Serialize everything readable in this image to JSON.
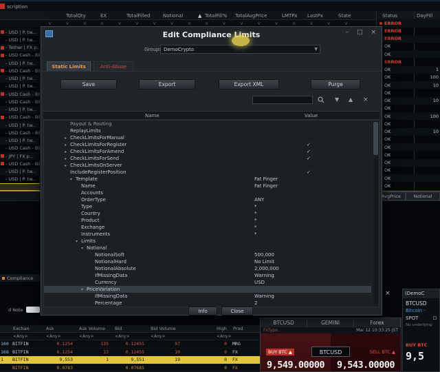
{
  "chrome": {
    "partial_header": "scription",
    "columns": [
      "TotalQty",
      "EX",
      "TotalFilled",
      "Notional",
      "TotalFill%",
      "TotalAvgPrice",
      "LMTPx",
      "LastPx",
      "State",
      "Status",
      "DayFill"
    ],
    "sort_indicator": "▲",
    "filter_glyphs": "∨ ∨ ∨ ∨ ∨ ∨ ∨ ∨ ∨ ∨ ∨ ∨ ∨ ∨ ∨ ∨ ∨ ∨",
    "left_rows": [
      {
        "label": "- USD | P. tw...",
        "marker": "red"
      },
      {
        "label": "- USD | P. tw...",
        "marker": ""
      },
      {
        "label": "- Tether | FX p...",
        "marker": "red"
      },
      {
        "label": "- USD Cash - Bitco...",
        "marker": "red"
      },
      {
        "label": "- USD | P. tw...",
        "marker": ""
      },
      {
        "label": "- USD Cash - Bitco...",
        "marker": "red"
      },
      {
        "label": "- USD | P. tw...",
        "marker": ""
      },
      {
        "label": "- USD | P. tw...",
        "marker": ""
      },
      {
        "label": "- USD Cash - Bitco...",
        "marker": "red"
      },
      {
        "label": "- USD Cash - Bitco...",
        "marker": ""
      },
      {
        "label": "- USD | P. tw...",
        "marker": ""
      },
      {
        "label": "- USD Cash - Bitco...",
        "marker": "red"
      },
      {
        "label": "- USD | P. tw...",
        "marker": ""
      },
      {
        "label": "- USD Cash - Bitco...",
        "marker": ""
      },
      {
        "label": "- USD | P. tw...",
        "marker": ""
      },
      {
        "label": "- USD Cash - Bitco...",
        "marker": ""
      },
      {
        "label": "- JPY | FX p...",
        "marker": "red"
      },
      {
        "label": "- USD Cash - Bitco...",
        "marker": "red"
      },
      {
        "label": "- USD | P. tw...",
        "marker": ""
      },
      {
        "label": "- USD | P. tw...",
        "marker": ""
      }
    ],
    "status_rows": [
      {
        "status": "ERROR",
        "value": ""
      },
      {
        "status": "ERROR",
        "value": ""
      },
      {
        "status": "ERROR",
        "value": ""
      },
      {
        "status": "OK",
        "value": ""
      },
      {
        "status": "OK",
        "value": ""
      },
      {
        "status": "ERROR",
        "value": ""
      },
      {
        "status": "OK",
        "value": "1"
      },
      {
        "status": "OK",
        "value": "100"
      },
      {
        "status": "OK",
        "value": "10"
      },
      {
        "status": "OK",
        "value": ""
      },
      {
        "status": "OK",
        "value": "10"
      },
      {
        "status": "OK",
        "value": ""
      },
      {
        "status": "OK",
        "value": "100"
      },
      {
        "status": "OK",
        "value": ""
      },
      {
        "status": "OK",
        "value": "10"
      },
      {
        "status": "OK",
        "value": ""
      },
      {
        "status": "OK",
        "value": ""
      },
      {
        "status": "OK",
        "value": ""
      },
      {
        "status": "OK",
        "value": ""
      },
      {
        "status": "OK",
        "value": ""
      },
      {
        "status": "OK",
        "value": ""
      },
      {
        "status": "OK",
        "value": ""
      }
    ],
    "mid": {
      "avgprice": "AvgPrice",
      "notional": "Notional"
    },
    "left_panel": {
      "compliance": "Compliance",
      "note": "d Note"
    }
  },
  "modal": {
    "title": "Edit Compliance Limits",
    "window_controls": {
      "minimize": "–",
      "maximize": "□",
      "close": "×"
    },
    "groups_label": "Groups",
    "groups_value": "DemoCrypto",
    "dropdown_arrow": "▼",
    "tabs": [
      {
        "label": "Static Limits"
      },
      {
        "label": "Anti-Abuse"
      }
    ],
    "buttons": {
      "save": "Save",
      "export": "Export",
      "export_xml": "Export XML",
      "purge": "Purge"
    },
    "search": {
      "value": "",
      "next": "▼",
      "prev": "▲",
      "clear": "×"
    },
    "table": {
      "name_header": "Name",
      "value_header": "Value"
    },
    "tree_rows": [
      {
        "name": "Payout & Routing",
        "exp": "",
        "value": "",
        "check": "",
        "lvl": "0",
        "sel": ""
      },
      {
        "name": "ReplayLimits",
        "exp": "",
        "value": "",
        "check": "",
        "lvl": "0",
        "sel": ""
      },
      {
        "name": "CheckLimitsForManual",
        "exp": "▸",
        "value": "",
        "check": "",
        "lvl": "0",
        "sel": ""
      },
      {
        "name": "CheckLimitsForRegister",
        "exp": "▸",
        "value": "",
        "check": "✓",
        "lvl": "0",
        "sel": ""
      },
      {
        "name": "CheckLimitsForAmend",
        "exp": "▸",
        "value": "",
        "check": "✓",
        "lvl": "0",
        "sel": ""
      },
      {
        "name": "CheckLimitsForSend",
        "exp": "▸",
        "value": "",
        "check": "✓",
        "lvl": "0",
        "sel": ""
      },
      {
        "name": "CheckLimitsOnServer",
        "exp": "▸",
        "value": "",
        "check": "",
        "lvl": "0",
        "sel": ""
      },
      {
        "name": "IncludeRegisterPosition",
        "exp": "",
        "value": "",
        "check": "✓",
        "lvl": "0",
        "sel": ""
      },
      {
        "name": "Template",
        "exp": "▾",
        "value": "Fat Finger",
        "check": "",
        "lvl": "1",
        "sel": ""
      },
      {
        "name": "Name",
        "exp": "",
        "value": "Fat Finger",
        "check": "",
        "lvl": "2",
        "sel": ""
      },
      {
        "name": "Accounts",
        "exp": "",
        "value": "",
        "check": "",
        "lvl": "2",
        "sel": ""
      },
      {
        "name": "OrderType",
        "exp": "",
        "value": "ANY",
        "check": "",
        "lvl": "2",
        "sel": ""
      },
      {
        "name": "Type",
        "exp": "",
        "value": "*",
        "check": "",
        "lvl": "2",
        "sel": ""
      },
      {
        "name": "Country",
        "exp": "",
        "value": "*",
        "check": "",
        "lvl": "2",
        "sel": ""
      },
      {
        "name": "Product",
        "exp": "",
        "value": "*",
        "check": "",
        "lvl": "2",
        "sel": ""
      },
      {
        "name": "Exchange",
        "exp": "",
        "value": "*",
        "check": "",
        "lvl": "2",
        "sel": ""
      },
      {
        "name": "Instruments",
        "exp": "",
        "value": "*",
        "check": "",
        "lvl": "2",
        "sel": ""
      },
      {
        "name": "Limits",
        "exp": "▾",
        "value": "",
        "check": "",
        "lvl": "2",
        "sel": ""
      },
      {
        "name": "Notional",
        "exp": "▾",
        "value": "",
        "check": "",
        "lvl": "3",
        "sel": ""
      },
      {
        "name": "NotionalSoft",
        "exp": "",
        "value": "500,000",
        "check": "",
        "lvl": "4",
        "sel": ""
      },
      {
        "name": "NotionalHard",
        "exp": "",
        "value": "No Limit",
        "check": "",
        "lvl": "4",
        "sel": ""
      },
      {
        "name": "NotionalAbsolute",
        "exp": "",
        "value": "2,000,000",
        "check": "",
        "lvl": "4",
        "sel": ""
      },
      {
        "name": "IfMissingData",
        "exp": "",
        "value": "Warning",
        "check": "",
        "lvl": "4",
        "sel": ""
      },
      {
        "name": "Currency",
        "exp": "",
        "value": "USD",
        "check": "",
        "lvl": "4",
        "sel": ""
      },
      {
        "name": "PriceVariation",
        "exp": "▾",
        "value": "",
        "check": "",
        "lvl": "3",
        "sel": "1"
      },
      {
        "name": "IfMissingData",
        "exp": "",
        "value": "Warning",
        "check": "",
        "lvl": "4",
        "sel": ""
      },
      {
        "name": "Percentage",
        "exp": "",
        "value": "2",
        "check": "",
        "lvl": "4",
        "sel": ""
      }
    ],
    "footer": {
      "info": "Info",
      "close": "Close"
    }
  },
  "quotes": {
    "headers": [
      {
        "label": "",
        "filter": ""
      },
      {
        "label": "Exchan",
        "filter": "<Any>"
      },
      {
        "label": "Ask",
        "filter": "<Any>"
      },
      {
        "label": "Ask Volume",
        "filter": "<Any>"
      },
      {
        "label": "Bid",
        "filter": "<Any>"
      },
      {
        "label": "Bid Volume",
        "filter": "<Any>"
      },
      {
        "label": "",
        "filter": ""
      },
      {
        "label": "High",
        "filter": "<Any>"
      },
      {
        "label": "Prod",
        "filter": ""
      }
    ],
    "rows": [
      {
        "num": "160",
        "exch": "BITFIN",
        "ask": "0.1254",
        "askvol": "135",
        "bid": "0.12455",
        "bidvol": "97",
        "blank": "",
        "high": "0",
        "prod": "MRG",
        "tone": "red"
      },
      {
        "num": "168",
        "exch": "BITFIN",
        "ask": "0.1254",
        "askvol": "13",
        "bid": "0.12455",
        "bidvol": "10",
        "blank": "",
        "high": "0",
        "prod": "FX",
        "tone": "red"
      },
      {
        "num": "1",
        "exch": "BITFIN",
        "ask": "9,553",
        "askvol": "1",
        "bid": "9,551",
        "bidvol": "19",
        "blank": "",
        "high": "0",
        "prod": "FX",
        "tone": "yellow"
      },
      {
        "num": "",
        "exch": "BITFIN",
        "ask": "0.0783",
        "askvol": "",
        "bid": "0.07685",
        "bidvol": "",
        "blank": "",
        "high": "0",
        "prod": "FX",
        "tone": "amber"
      }
    ]
  },
  "ticket": {
    "tabs": [
      "BTCUSD",
      "GEMINI",
      "Forex"
    ],
    "fx_label": "FxType..",
    "timestamp": "Mar 12 10:33:25 JST",
    "buy_label": "BUY BTC",
    "sell_label": "SELL BTC",
    "arrow": "▲",
    "pair": "BTCUSD",
    "buy_price": "9,549.00000",
    "sell_price": "9,543.00000"
  },
  "side_ticket": {
    "header": "(DemoC",
    "close": "×",
    "pair": "BTCUSD",
    "name": "Bitcoin -",
    "type": "SPOT",
    "underlying": "No underlying",
    "buy_label": "BUY BTC",
    "partial_price": "9,5"
  }
}
